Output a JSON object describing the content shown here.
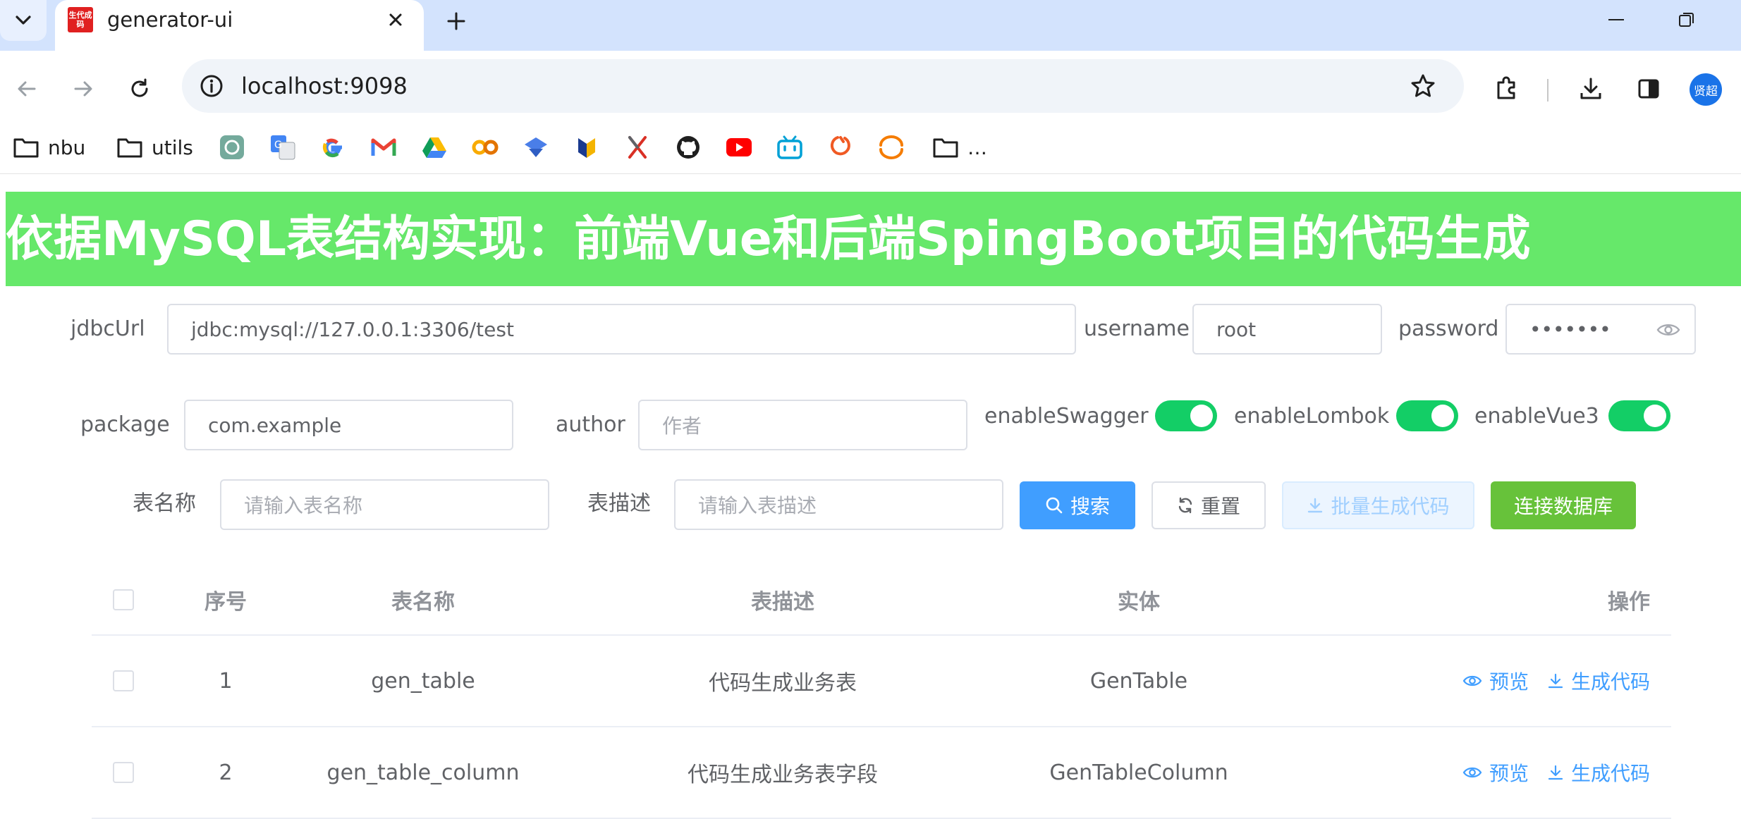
{
  "browser": {
    "tab_title": "generator-ui",
    "favicon_text": "生代成码",
    "url": "localhost:9098",
    "avatar_text": "贤超",
    "bookmarks": [
      {
        "label": "nbu",
        "icon": "folder-icon"
      },
      {
        "label": "utils",
        "icon": "folder-icon"
      },
      {
        "label": "",
        "icon": "chatgpt-icon"
      },
      {
        "label": "",
        "icon": "google-translate-icon"
      },
      {
        "label": "",
        "icon": "google-icon"
      },
      {
        "label": "",
        "icon": "gmail-icon"
      },
      {
        "label": "",
        "icon": "google-drive-icon"
      },
      {
        "label": "",
        "icon": "colab-icon"
      },
      {
        "label": "",
        "icon": "bookmark-app-icon"
      },
      {
        "label": "",
        "icon": "bookmark-app-icon"
      },
      {
        "label": "",
        "icon": "bookmark-app-icon"
      },
      {
        "label": "",
        "icon": "github-icon"
      },
      {
        "label": "",
        "icon": "youtube-icon"
      },
      {
        "label": "",
        "icon": "bilibili-icon"
      },
      {
        "label": "",
        "icon": "bookmark-app-icon"
      },
      {
        "label": "",
        "icon": "bookmark-app-icon"
      },
      {
        "label": "…",
        "icon": "folder-icon"
      }
    ]
  },
  "banner": {
    "text": "依据MySQL表结构实现：前端Vue和后端SpingBoot项目的代码生成"
  },
  "connection": {
    "jdbc_label": "jdbcUrl",
    "jdbc_value": "jdbc:mysql://127.0.0.1:3306/test",
    "username_label": "username",
    "username_value": "root",
    "password_label": "password",
    "password_value": "•••••••"
  },
  "options": {
    "package_label": "package",
    "package_value": "com.example",
    "author_label": "author",
    "author_placeholder": "作者",
    "swagger_label": "enableSwagger",
    "swagger_on": true,
    "lombok_label": "enableLombok",
    "lombok_on": true,
    "vue3_label": "enableVue3",
    "vue3_on": true
  },
  "search": {
    "table_name_label": "表名称",
    "table_name_placeholder": "请输入表名称",
    "table_desc_label": "表描述",
    "table_desc_placeholder": "请输入表描述",
    "search_button": "搜索",
    "reset_button": "重置",
    "batch_button": "批量生成代码",
    "connect_button": "连接数据库"
  },
  "table": {
    "headers": {
      "index": "序号",
      "name": "表名称",
      "desc": "表描述",
      "entity": "实体",
      "ops": "操作"
    },
    "rows": [
      {
        "index": "1",
        "name": "gen_table",
        "desc": "代码生成业务表",
        "entity": "GenTable"
      },
      {
        "index": "2",
        "name": "gen_table_column",
        "desc": "代码生成业务表字段",
        "entity": "GenTableColumn"
      }
    ],
    "preview_label": "预览",
    "generate_label": "生成代码"
  },
  "colors": {
    "banner_bg": "#66e86a",
    "primary": "#409eff",
    "success": "#67c23a",
    "switch_on": "#13ce66"
  }
}
